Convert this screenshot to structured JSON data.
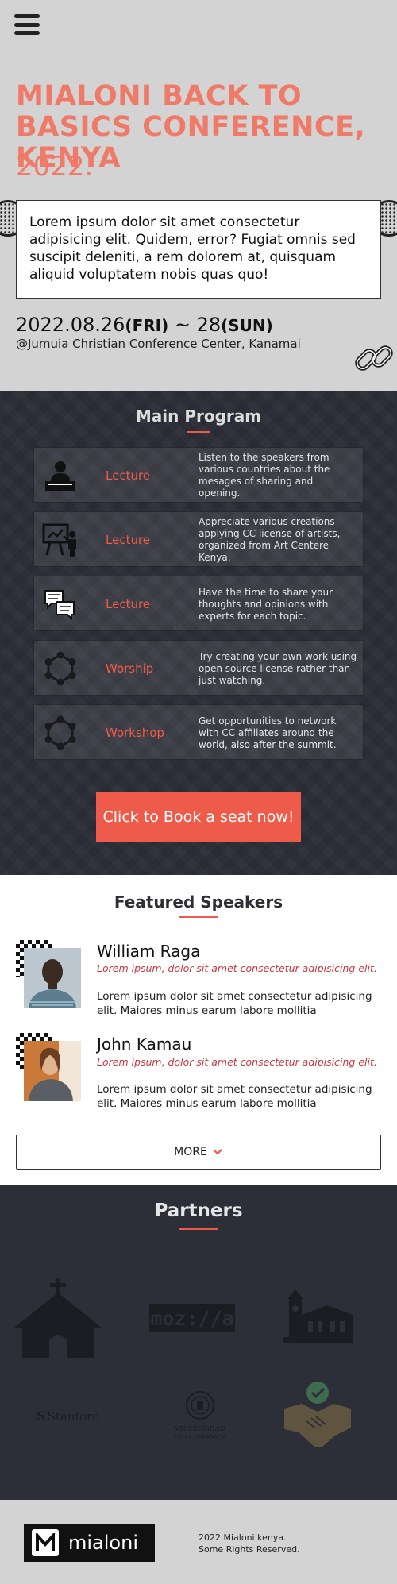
{
  "hero": {
    "title": "MIALONI BACK TO BASICS CONFERENCE, KENYA",
    "year": "2022.",
    "intro": "Lorem ipsum dolor sit amet consectetur adipisicing elit. Quidem, error? Fugiat omnis sed suscipit deleniti, a rem dolorem at, quisquam aliquid voluptatem nobis quas quo!",
    "date_start": "2022.08.26",
    "day_start": "(FRI)",
    "date_sep": " ~ 28",
    "day_end": "(SUN)",
    "venue": "@Jumuia Christian Conference Center, Kanamai"
  },
  "program": {
    "title": "Main Program",
    "items": [
      {
        "type": "Lecture",
        "icon": "speaker-podium-icon",
        "desc": "Listen to the speakers from various countries about the mesages of sharing and opening."
      },
      {
        "type": "Lecture",
        "icon": "presentation-board-icon",
        "desc": "Appreciate various creations applying CC license of artists, organized from Art Centere Kenya."
      },
      {
        "type": "Lecture",
        "icon": "chat-bubbles-icon",
        "desc": "Have the time to share your thoughts and opinions with experts for each topic."
      },
      {
        "type": "Worship",
        "icon": "network-hexagon-icon",
        "desc": "Try creating your own work using open source license rather than just watching."
      },
      {
        "type": "Workshop",
        "icon": "network-hexagon-icon",
        "desc": "Get opportunities to network with CC affiliates around the world, also after the summit."
      }
    ],
    "cta": "Click to Book a seat now!"
  },
  "speakers": {
    "title": "Featured Speakers",
    "list": [
      {
        "name": "William Raga",
        "role": "Lorem ipsum, dolor sit amet consectetur adipisicing elit.",
        "bio": "Lorem ipsum dolor sit amet consectetur adipisicing elit. Maiores minus earum labore mollitia"
      },
      {
        "name": "John Kamau",
        "role": "Lorem ipsum, dolor sit amet consectetur adipisicing elit.",
        "bio": "Lorem ipsum dolor sit amet consectetur adipisicing elit. Maiores minus earum labore mollitia"
      }
    ],
    "more": "MORE"
  },
  "partners": {
    "title": "Partners",
    "logos": [
      "church-logo",
      "mozilla-logo",
      "school-building-logo",
      "stanford-logo",
      "university-salamanca-logo",
      "handshake-check-logo"
    ],
    "mozilla_text": "moz://a",
    "stanford_text": "Stanford",
    "salamanca_line1": "VNiVERSiDAD",
    "salamanca_line2": "DSALAMANCA"
  },
  "footer": {
    "logo_text": "mialoni",
    "copy_line1": "2022 Mialoni kenya.",
    "copy_line2": "Some Rights Reserved."
  },
  "colors": {
    "accent": "#ef5a49",
    "title_coral": "#f07a68",
    "dark_bg": "#2d2f38",
    "light_bg": "#d3d3d3"
  }
}
